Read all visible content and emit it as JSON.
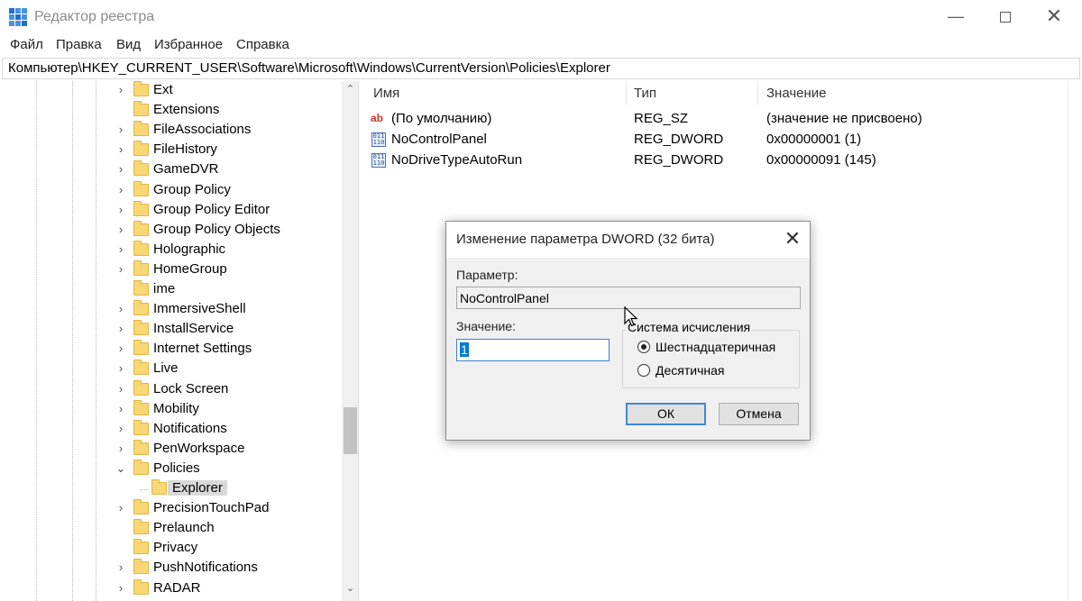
{
  "window": {
    "title": "Редактор реестра",
    "minimize": "—",
    "close": "✕"
  },
  "menu": [
    "Файл",
    "Правка",
    "Вид",
    "Избранное",
    "Справка"
  ],
  "address": "Компьютер\\HKEY_CURRENT_USER\\Software\\Microsoft\\Windows\\CurrentVersion\\Policies\\Explorer",
  "tree": {
    "items": [
      {
        "label": "Ext",
        "expander": "›"
      },
      {
        "label": "Extensions",
        "expander": ""
      },
      {
        "label": "FileAssociations",
        "expander": "›"
      },
      {
        "label": "FileHistory",
        "expander": "›"
      },
      {
        "label": "GameDVR",
        "expander": "›"
      },
      {
        "label": "Group Policy",
        "expander": "›"
      },
      {
        "label": "Group Policy Editor",
        "expander": "›"
      },
      {
        "label": "Group Policy Objects",
        "expander": "›"
      },
      {
        "label": "Holographic",
        "expander": "›"
      },
      {
        "label": "HomeGroup",
        "expander": "›"
      },
      {
        "label": "ime",
        "expander": ""
      },
      {
        "label": "ImmersiveShell",
        "expander": "›"
      },
      {
        "label": "InstallService",
        "expander": "›"
      },
      {
        "label": "Internet Settings",
        "expander": "›"
      },
      {
        "label": "Live",
        "expander": "›"
      },
      {
        "label": "Lock Screen",
        "expander": "›"
      },
      {
        "label": "Mobility",
        "expander": "›"
      },
      {
        "label": "Notifications",
        "expander": "›"
      },
      {
        "label": "PenWorkspace",
        "expander": "›"
      },
      {
        "label": "Policies",
        "expander": "⌄"
      },
      {
        "label": "Explorer",
        "expander": "",
        "child": true,
        "selected": true
      },
      {
        "label": "PrecisionTouchPad",
        "expander": "›"
      },
      {
        "label": "Prelaunch",
        "expander": ""
      },
      {
        "label": "Privacy",
        "expander": ""
      },
      {
        "label": "PushNotifications",
        "expander": "›"
      },
      {
        "label": "RADAR",
        "expander": "›"
      }
    ]
  },
  "list": {
    "columns": {
      "name": "Имя",
      "type": "Тип",
      "value": "Значение"
    },
    "rows": [
      {
        "name": "(По умолчанию)",
        "type": "REG_SZ",
        "value": "(значение не присвоено)",
        "icon": "string-value-icon"
      },
      {
        "name": "NoControlPanel",
        "type": "REG_DWORD",
        "value": "0x00000001 (1)",
        "icon": "binary-value-icon"
      },
      {
        "name": "NoDriveTypeAutoRun",
        "type": "REG_DWORD",
        "value": "0x00000091 (145)",
        "icon": "binary-value-icon"
      }
    ],
    "string_icon_text": "ab",
    "binary_icon_text": "011 110"
  },
  "dialog": {
    "title": "Изменение параметра DWORD (32 бита)",
    "close": "✕",
    "param_label": "Параметр:",
    "param_value": "NoControlPanel",
    "value_label": "Значение:",
    "value": "1",
    "base_label": "Система исчисления",
    "hex_label": "Шестнадцатеричная",
    "dec_label": "Десятичная",
    "ok": "ОК",
    "cancel": "Отмена"
  },
  "colors": {
    "accent": "#0078d7",
    "folder": "#f8d775",
    "selection": "#d9d9d9"
  }
}
